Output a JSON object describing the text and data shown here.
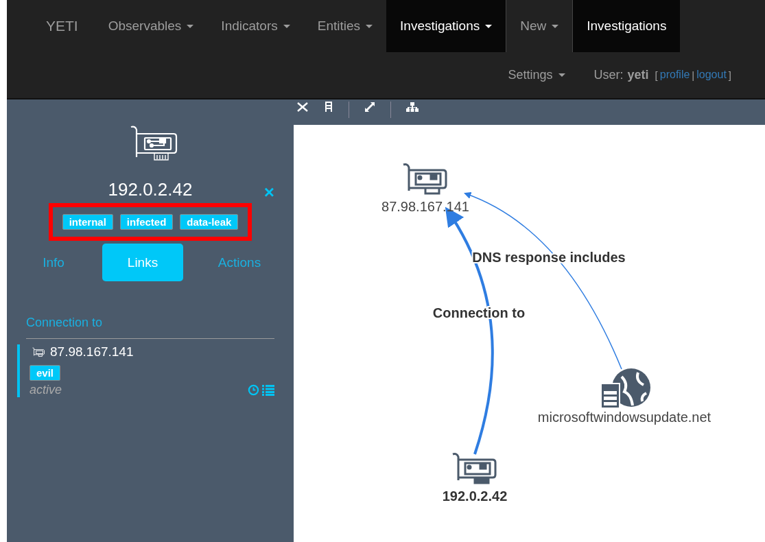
{
  "navbar": {
    "brand": "YETI",
    "items": [
      {
        "label": "Observables",
        "dropdown": true,
        "selected": false
      },
      {
        "label": "Indicators",
        "dropdown": true,
        "selected": false
      },
      {
        "label": "Entities",
        "dropdown": true,
        "selected": false
      },
      {
        "label": "Investigations",
        "dropdown": true,
        "selected": true
      },
      {
        "label": "New",
        "dropdown": true,
        "selected": false
      },
      {
        "label": "Investigations",
        "dropdown": false,
        "selected": true
      }
    ],
    "settings": "Settings",
    "user_label": "User:",
    "username": "yeti",
    "profile": "profile",
    "separator": "|",
    "logout": "logout",
    "bracket_open": "[",
    "bracket_close": "]"
  },
  "sidebar": {
    "title": "192.0.2.42",
    "close": "×",
    "tags_highlighted": true,
    "tags": [
      "internal",
      "infected",
      "data-leak"
    ],
    "tabs": [
      {
        "label": "Info",
        "selected": false
      },
      {
        "label": "Links",
        "selected": true
      },
      {
        "label": "Actions",
        "selected": false
      }
    ],
    "section": "Connection to",
    "links": [
      {
        "name": "87.98.167.141",
        "tags": [
          "evil"
        ],
        "status": "active"
      }
    ]
  },
  "graph": {
    "nodes": [
      {
        "kind": "ip",
        "label": "87.98.167.141",
        "selected": false
      },
      {
        "kind": "ip",
        "label": "192.0.2.42",
        "selected": true
      },
      {
        "kind": "hostname",
        "label": "microsoftwindowsupdate.net",
        "selected": false
      }
    ],
    "edges": [
      {
        "label": "DNS response includes",
        "highlighted": false
      },
      {
        "label": "Connection to",
        "highlighted": true
      }
    ]
  }
}
